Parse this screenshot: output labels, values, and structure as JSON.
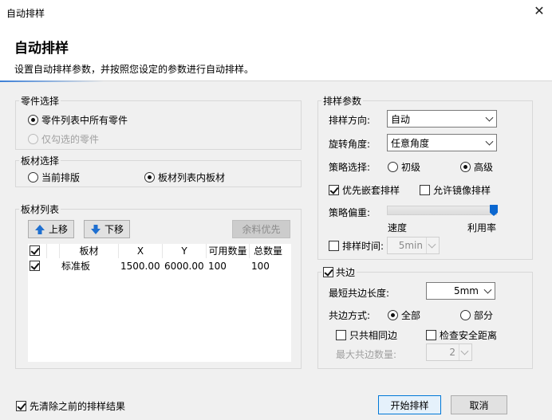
{
  "window": {
    "title": "自动排样",
    "close_glyph": "✕"
  },
  "header": {
    "title": "自动排样",
    "subtitle": "设置自动排样参数，并按照您设定的参数进行自动排样。"
  },
  "parts_group": {
    "legend": "零件选择",
    "options": [
      "零件列表中所有零件",
      "仅勾选的零件"
    ],
    "selected": 0
  },
  "sheet_group": {
    "legend": "板材选择",
    "options": [
      "当前排版",
      "板材列表内板材"
    ],
    "selected": 1
  },
  "sheet_list": {
    "legend": "板材列表",
    "up_label": "上移",
    "down_label": "下移",
    "surplus_label": "余料优先",
    "columns": [
      "板材",
      "X",
      "Y",
      "可用数量",
      "总数量"
    ],
    "rows": [
      {
        "checked": true,
        "name": "标准板",
        "x": "1500.00",
        "y": "6000.00",
        "available": "100",
        "total": "100"
      }
    ]
  },
  "nesting_params": {
    "legend": "排样参数",
    "direction_label": "排样方向:",
    "direction_value": "自动",
    "rotation_label": "旋转角度:",
    "rotation_value": "任意角度",
    "strategy_label": "策略选择:",
    "strategy_options": [
      "初级",
      "高级"
    ],
    "strategy_selected": 1,
    "nest_first_label": "优先嵌套排样",
    "nest_first_checked": true,
    "mirror_label": "允许镜像排样",
    "mirror_checked": false,
    "bias_label": "策略偏重:",
    "bias_left": "速度",
    "bias_right": "利用率",
    "bias_value": 1.0,
    "time_label": "排样时间:",
    "time_checked": false,
    "time_value": "5min"
  },
  "common_edge": {
    "legend": "共边",
    "enabled": true,
    "min_length_label": "最短共边长度:",
    "min_length_value": "5mm",
    "mode_label": "共边方式:",
    "mode_options": [
      "全部",
      "部分"
    ],
    "mode_selected": 0,
    "same_only_label": "只共相同边",
    "same_only_checked": false,
    "safe_dist_label": "检查安全距离",
    "safe_dist_checked": false,
    "max_count_label": "最大共边数量:",
    "max_count_value": "2"
  },
  "footer": {
    "clear_label": "先清除之前的排样结果",
    "clear_checked": true,
    "start_label": "开始排样",
    "cancel_label": "取消"
  }
}
